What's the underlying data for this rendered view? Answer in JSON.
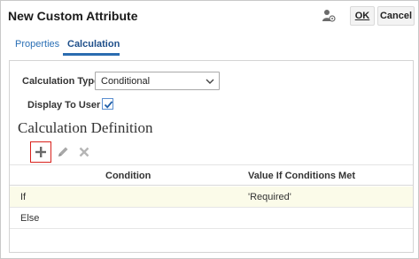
{
  "dialog": {
    "title": "New Custom Attribute",
    "ok_label": "OK",
    "cancel_label": "Cancel",
    "user_icon": "user-settings-icon"
  },
  "tabs": [
    {
      "label": "Properties",
      "selected": false
    },
    {
      "label": "Calculation",
      "selected": true
    }
  ],
  "form": {
    "calculation_type_label": "Calculation Type",
    "calculation_type_value": "Conditional",
    "display_to_user_label": "Display To User",
    "display_to_user_checked": true
  },
  "section": {
    "title": "Calculation Definition"
  },
  "toolbar": {
    "add_icon": "plus-icon",
    "edit_icon": "pencil-icon",
    "delete_icon": "x-icon"
  },
  "table": {
    "columns": [
      "Condition",
      "Value If Conditions Met"
    ],
    "rows": [
      {
        "condition": "If",
        "value": "'Required'"
      },
      {
        "condition": "Else",
        "value": ""
      }
    ]
  },
  "colors": {
    "accent": "#2b6cb0",
    "highlight_row": "#fbfbe9",
    "add_border": "#d9211c"
  }
}
